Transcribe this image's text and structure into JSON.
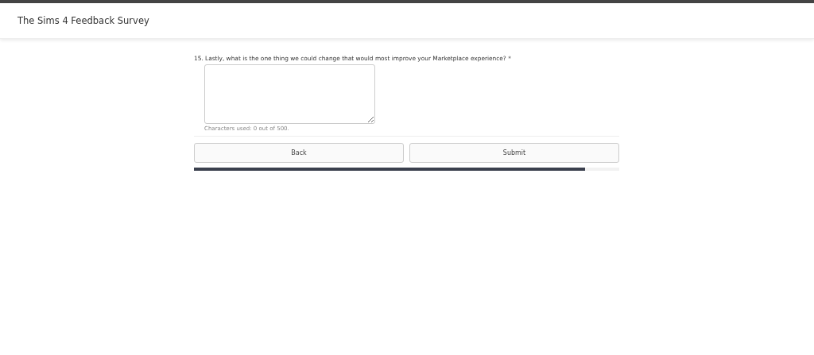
{
  "header": {
    "title": "The Sims 4 Feedback Survey"
  },
  "question": {
    "text": "15. Lastly, what is the one thing we could change that would most improve your Marketplace experience? *",
    "counter": "Characters used: 0  out of 500."
  },
  "buttons": [
    {
      "label": "Back"
    },
    {
      "label": "Submit"
    }
  ],
  "progress": {
    "level": 0.92
  }
}
